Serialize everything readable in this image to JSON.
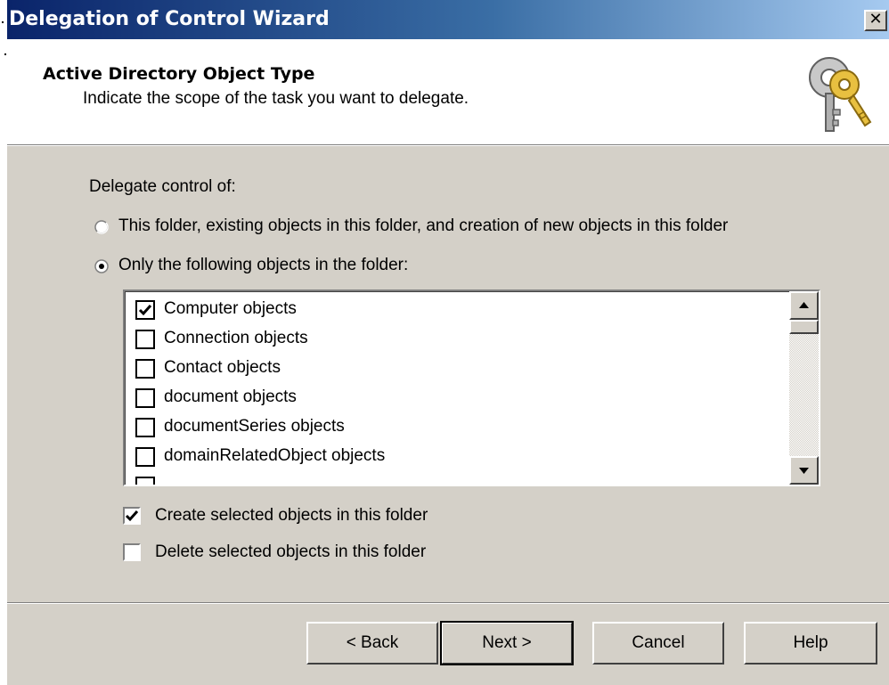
{
  "window": {
    "title": "Delegation of Control Wizard",
    "close_glyph": "✕"
  },
  "header": {
    "title": "Active Directory Object Type",
    "subtitle": "Indicate the scope of the task you want to delegate.",
    "icon": "keys-icon"
  },
  "main": {
    "delegate_label": "Delegate control of:",
    "options": [
      {
        "label": "This folder, existing objects in this folder, and creation of new objects in this folder",
        "selected": false
      },
      {
        "label": "Only the following objects in the folder:",
        "selected": true
      }
    ],
    "object_list": [
      {
        "label": "Computer objects",
        "checked": true
      },
      {
        "label": "Connection objects",
        "checked": false
      },
      {
        "label": "Contact objects",
        "checked": false
      },
      {
        "label": "document objects",
        "checked": false
      },
      {
        "label": "documentSeries objects",
        "checked": false
      },
      {
        "label": "domainRelatedObject objects",
        "checked": false
      }
    ],
    "create_label": "Create selected objects in this folder",
    "create_checked": true,
    "delete_label": "Delete selected objects in this folder",
    "delete_checked": false
  },
  "footer": {
    "back_label": "< Back",
    "next_label": "Next >",
    "cancel_label": "Cancel",
    "help_label": "Help"
  }
}
